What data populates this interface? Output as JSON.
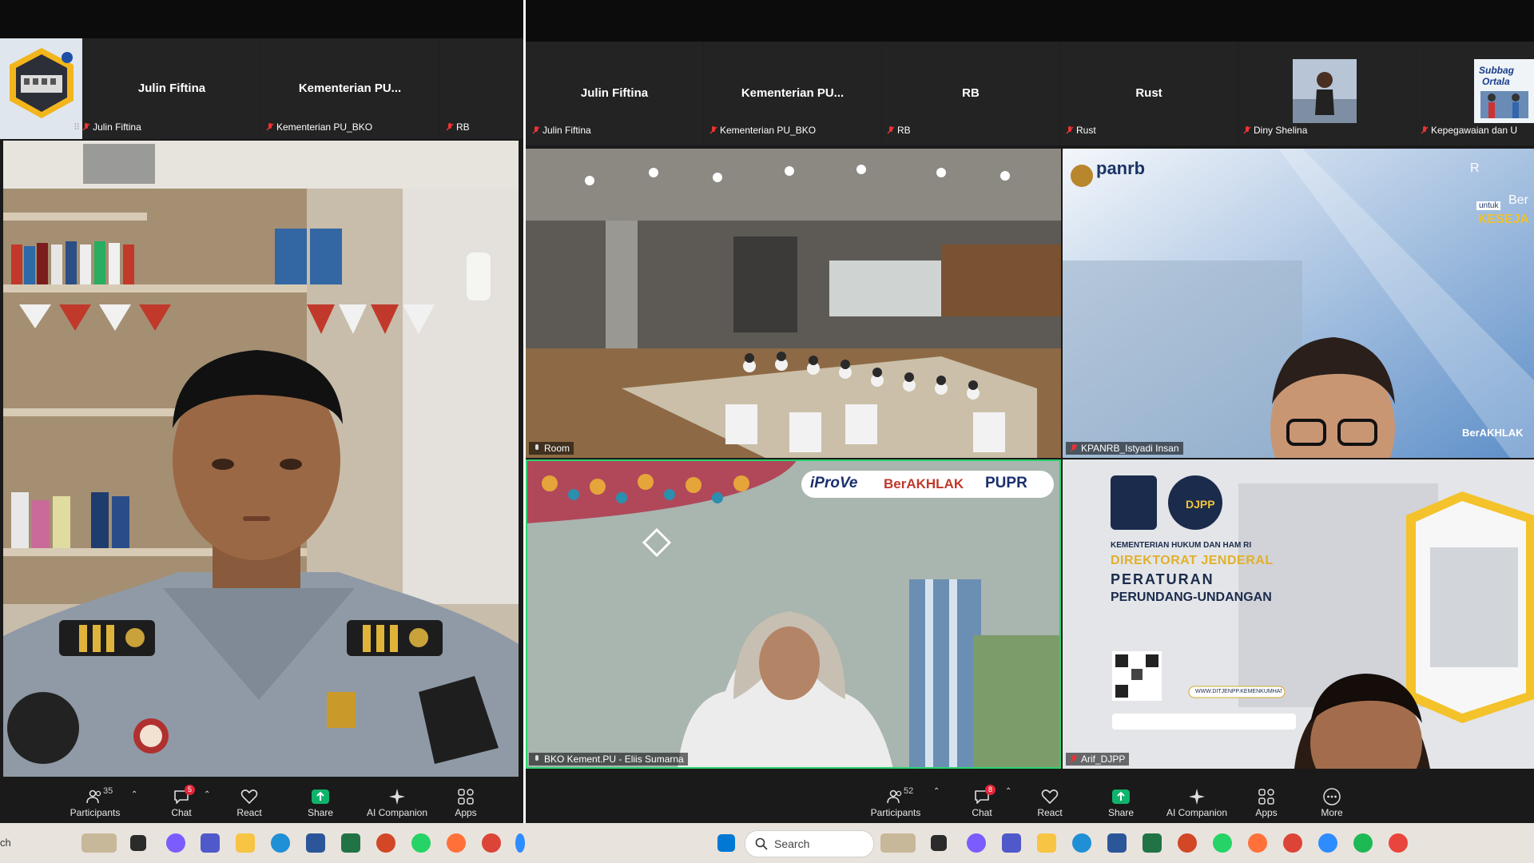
{
  "left": {
    "strip": {
      "names": [
        "Julin Fiftina",
        "Kementerian PU..."
      ],
      "labels": [
        "Julin Fiftina",
        "Kementerian PU_BKO",
        "RB"
      ]
    },
    "toolbar": {
      "participants": {
        "label": "Participants",
        "count": "35"
      },
      "chat": {
        "label": "Chat",
        "badge": "5"
      },
      "react": "React",
      "share": "Share",
      "ai": "AI Companion",
      "apps": "Apps"
    }
  },
  "right": {
    "strip": {
      "names": [
        "Julin Fiftina",
        "Kementerian PU...",
        "RB",
        "Rust"
      ],
      "labels": [
        "Julin Fiftina",
        "Kementerian PU_BKO",
        "RB",
        "Rust",
        "Diny Shelina",
        "Kepegawaian dan U"
      ],
      "tile_logo": "Subbag Ortala"
    },
    "tiles": {
      "room": "Room",
      "panrb": "KPANRB_Istyadi Insan",
      "bko": "BKO Kement.PU - Eliis Sumarna",
      "djpp": "Arif_DJPP"
    },
    "slides": {
      "panrb_logo": "panrb",
      "panrb_untuk": "untuk",
      "panrb_ber": "Ber",
      "panrb_kesejah": "KESEJA",
      "panrb_r": "R",
      "panrb_berakhlak": "BerAKHLAK",
      "iprove": "iProVe",
      "berakhlak": "BerAKHLAK",
      "pupr": "PUPR",
      "djpp_ministry": "KEMENTERIAN HUKUM DAN HAM RI",
      "djpp_line1": "DIREKTORAT JENDERAL",
      "djpp_line2": "PERATURAN",
      "djpp_line3": "PERUNDANG-UNDANGAN",
      "djpp_logo": "DJPP",
      "djpp_url": "WWW.DITJENPP.KEMENKUMHAM.GO"
    },
    "toolbar": {
      "participants": {
        "label": "Participants",
        "count": "52"
      },
      "chat": {
        "label": "Chat",
        "badge": "8"
      },
      "react": "React",
      "share": "Share",
      "ai": "AI Companion",
      "apps": "Apps",
      "more": "More"
    }
  },
  "taskbar": {
    "search_placeholder": "Search",
    "left_search_fragment": "ch"
  },
  "colors": {
    "zoom_share": "#0fb36b",
    "zoom_bg": "#1a1a1a",
    "taskbar": "#e9e3dd",
    "active_speaker": "#2ad36e"
  }
}
